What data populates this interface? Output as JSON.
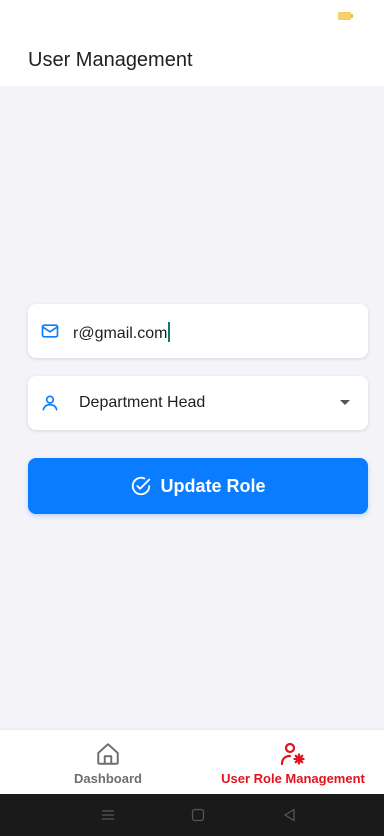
{
  "app_bar": {
    "title": "User Management"
  },
  "email_field": {
    "value": "r@gmail.com",
    "icon": "mail-icon"
  },
  "role_select": {
    "selected": "Department Head",
    "icon": "user-icon"
  },
  "update_button": {
    "label": "Update Role",
    "icon": "check-circle-icon"
  },
  "bottom_nav": {
    "items": [
      {
        "label": "Dashboard",
        "icon": "home-icon",
        "active": false
      },
      {
        "label": "User Role Management",
        "icon": "user-gear-icon",
        "active": true
      }
    ]
  },
  "colors": {
    "primary": "#0a7cff",
    "active_nav": "#e0141e",
    "inactive_nav": "#6e6e6e",
    "content_background": "#f3f3f8",
    "cursor": "#0e7a68"
  }
}
